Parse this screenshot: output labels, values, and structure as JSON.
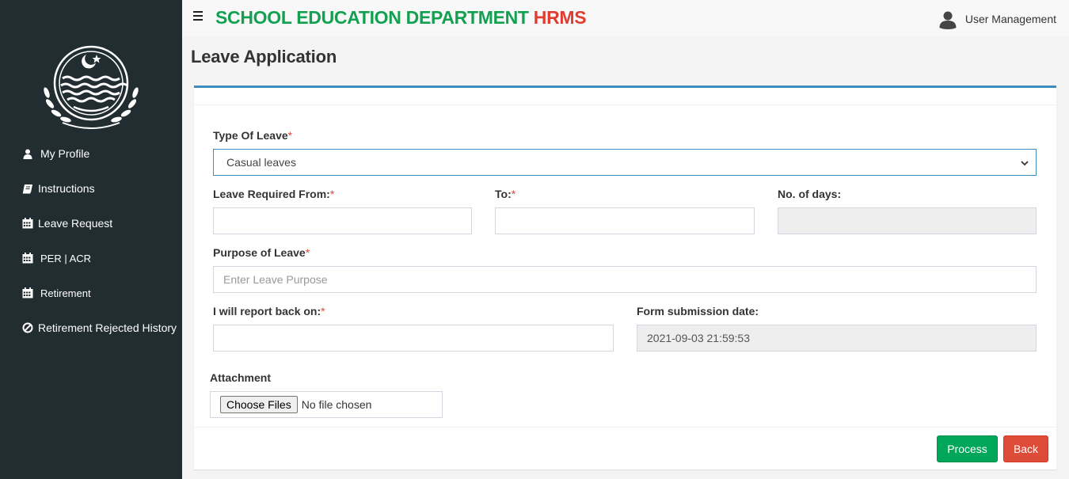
{
  "header": {
    "brand_main": "SCHOOL EDUCATION DEPARTMENT",
    "brand_accent": "HRMS",
    "user_label": "User Management",
    "colors": {
      "brand_green": "#12a150",
      "brand_red": "#e03c31"
    }
  },
  "sidebar": {
    "logo": "Government of the Punjab emblem",
    "items": [
      {
        "label": "My Profile",
        "icon": "user-icon"
      },
      {
        "label": "Instructions",
        "icon": "book-icon"
      },
      {
        "label": "Leave Request",
        "icon": "calendar-icon"
      },
      {
        "label": "PER | ACR",
        "icon": "calendar-icon"
      },
      {
        "label": "Retirement",
        "icon": "calendar-icon"
      },
      {
        "label": "Retirement Rejected History",
        "icon": "ban-icon"
      }
    ],
    "colors": {
      "background": "#222d32"
    }
  },
  "page": {
    "title": "Leave Application"
  },
  "form": {
    "required_mark": "*",
    "type_of_leave": {
      "label": "Type Of Leave",
      "value": "Casual leaves"
    },
    "leave_from": {
      "label": "Leave Required From:",
      "value": ""
    },
    "leave_to": {
      "label": "To:",
      "value": ""
    },
    "num_days": {
      "label": "No. of days:",
      "value": ""
    },
    "purpose": {
      "label": "Purpose of Leave",
      "placeholder": "Enter Leave Purpose",
      "value": ""
    },
    "report_back": {
      "label": "I will report back on:",
      "value": ""
    },
    "submission_date": {
      "label": "Form submission date:",
      "value": "2021-09-03 21:59:53"
    },
    "attachment": {
      "label": "Attachment",
      "button_label": "Choose Files",
      "status": "No file chosen"
    }
  },
  "actions": {
    "process_label": "Process",
    "back_label": "Back",
    "colors": {
      "process": "#00a65a",
      "back": "#dd4b39",
      "box_accent": "#3c8dbc"
    }
  }
}
